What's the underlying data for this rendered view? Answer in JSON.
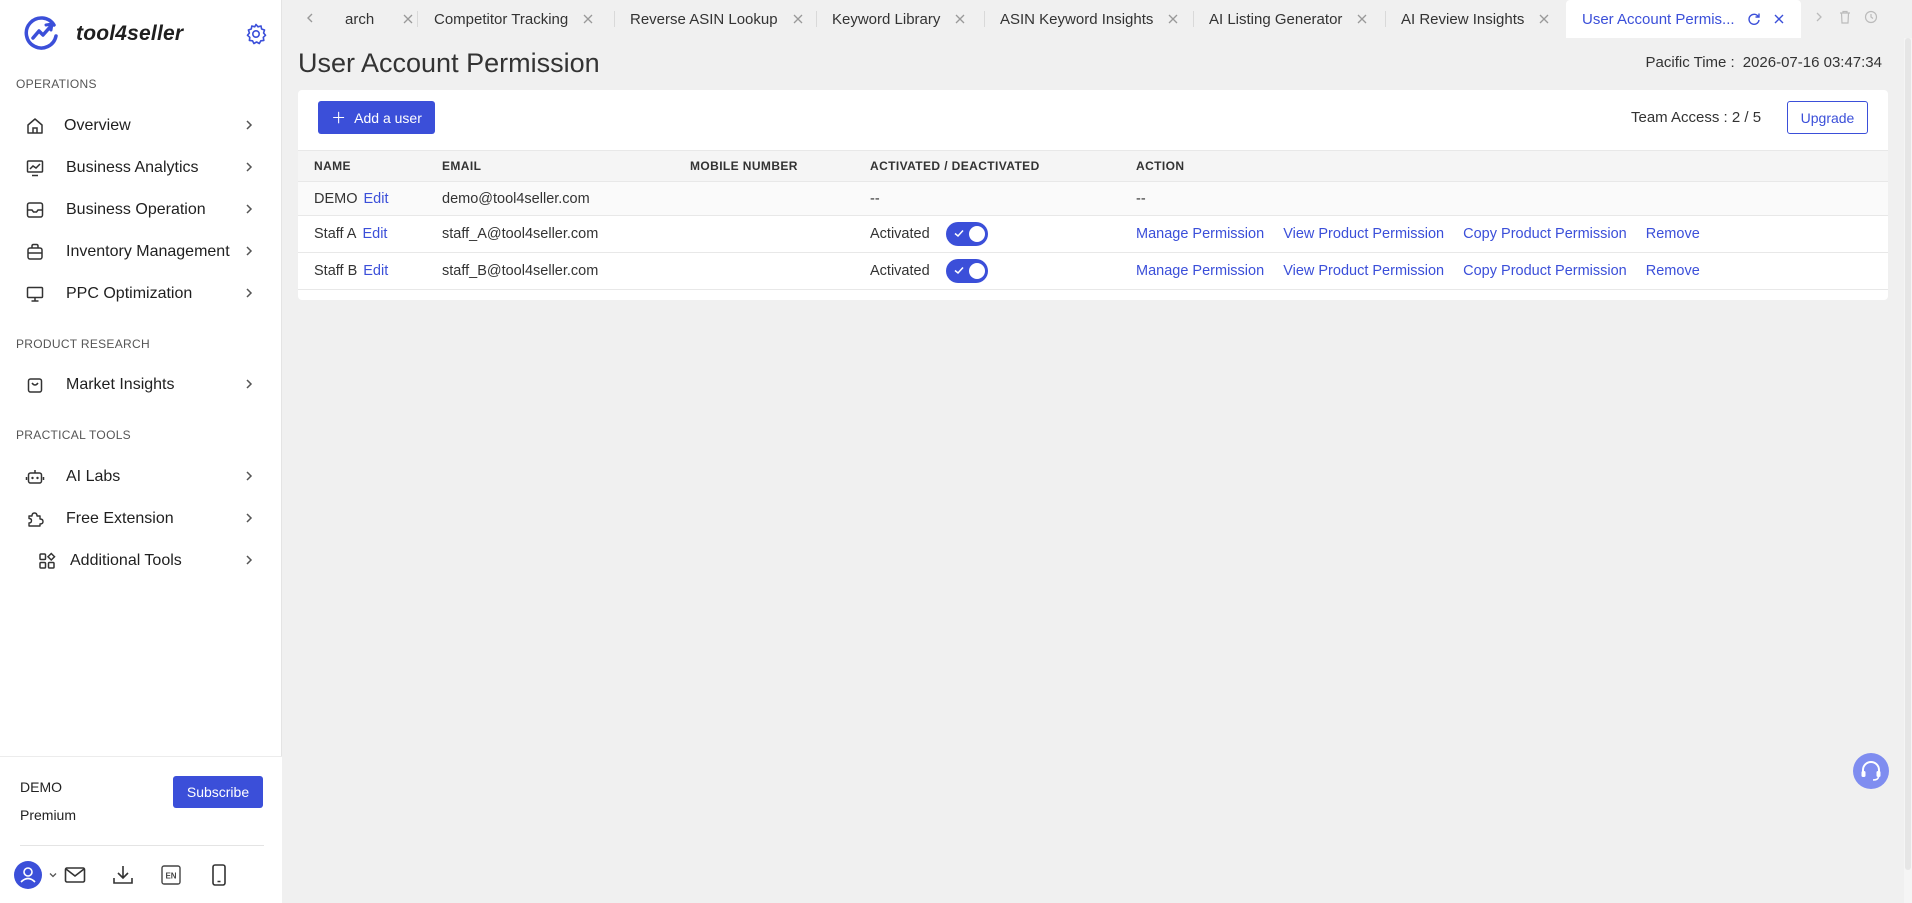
{
  "app": {
    "name": "tool4seller"
  },
  "colors": {
    "accent": "#3b4fd9",
    "text": "#333333",
    "background": "#f0f0f0",
    "support": "#7f8df0"
  },
  "sidebar": {
    "sections": [
      {
        "title": "OPERATIONS"
      },
      {
        "title": "PRODUCT RESEARCH"
      },
      {
        "title": "PRACTICAL TOOLS"
      }
    ],
    "items": [
      {
        "label": "Overview",
        "icon": "home-icon"
      },
      {
        "label": "Business Analytics",
        "icon": "chart-icon"
      },
      {
        "label": "Business Operation",
        "icon": "inbox-icon"
      },
      {
        "label": "Inventory Management",
        "icon": "box-icon"
      },
      {
        "label": "PPC Optimization",
        "icon": "monitor-icon"
      },
      {
        "label": "Market Insights",
        "icon": "shopping-bag-icon"
      },
      {
        "label": "AI Labs",
        "icon": "robot-icon"
      },
      {
        "label": "Free Extension",
        "icon": "puzzle-icon"
      },
      {
        "label": "Additional Tools",
        "icon": "grid-icon"
      }
    ],
    "user": {
      "name": "DEMO",
      "plan": "Premium",
      "subscribe_label": "Subscribe"
    },
    "bottom_icons": [
      "user-icon",
      "mail-icon",
      "download-icon",
      "language-en-icon",
      "mobile-icon"
    ]
  },
  "tabs": [
    {
      "label": "arch"
    },
    {
      "label": "Competitor Tracking"
    },
    {
      "label": "Reverse ASIN Lookup"
    },
    {
      "label": "Keyword Library"
    },
    {
      "label": "ASIN Keyword Insights"
    },
    {
      "label": "AI Listing Generator"
    },
    {
      "label": "AI Review Insights"
    },
    {
      "label": "User Account Permis...",
      "active": true
    }
  ],
  "page": {
    "title": "User Account Permission",
    "pacific_time_label": "Pacific Time :",
    "pacific_time_value": "2026-07-16 03:47:34",
    "add_user_label": "Add a user",
    "team_access_label": "Team Access :",
    "team_access_used": "2",
    "team_access_sep": "/",
    "team_access_total": "5",
    "upgrade_label": "Upgrade"
  },
  "table": {
    "headers": [
      "NAME",
      "EMAIL",
      "MOBILE NUMBER",
      "ACTIVATED / DEACTIVATED",
      "ACTION"
    ],
    "rows": [
      {
        "name": "DEMO",
        "edit": "Edit",
        "email": "demo@tool4seller.com",
        "mobile": "",
        "status": "--",
        "action": "--"
      },
      {
        "name": "Staff A",
        "edit": "Edit",
        "email": "staff_A@tool4seller.com",
        "mobile": "",
        "status": "Activated",
        "toggle_on": true,
        "actions": [
          "Manage Permission",
          "View Product Permission",
          "Copy Product Permission",
          "Remove"
        ]
      },
      {
        "name": "Staff B",
        "edit": "Edit",
        "email": "staff_B@tool4seller.com",
        "mobile": "",
        "status": "Activated",
        "toggle_on": true,
        "actions": [
          "Manage Permission",
          "View Product Permission",
          "Copy Product Permission",
          "Remove"
        ]
      }
    ]
  }
}
